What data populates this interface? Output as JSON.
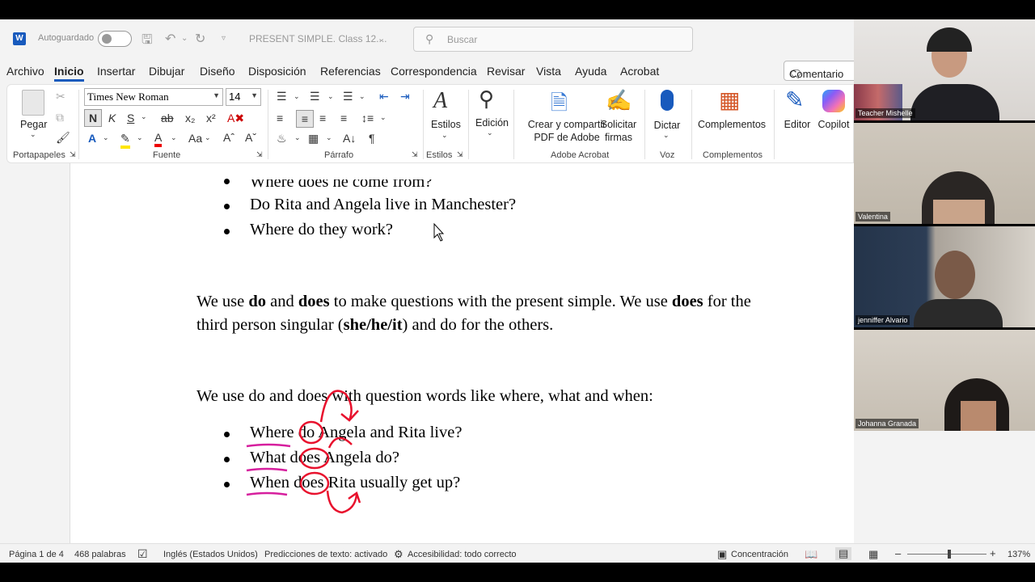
{
  "titlebar": {
    "autosave_label": "Autoguardado",
    "doc_title": "PRESENT SIMPLE. Class 12....",
    "search_placeholder": "Buscar"
  },
  "menu": {
    "items": [
      "Archivo",
      "Inicio",
      "Insertar",
      "Dibujar",
      "Diseño",
      "Disposición",
      "Referencias",
      "Correspondencia",
      "Revisar",
      "Vista",
      "Ayuda",
      "Acrobat"
    ],
    "comment_label": "Comentario"
  },
  "ribbon": {
    "paste_label": "Pegar",
    "font_name": "Times New Roman",
    "font_size": "14",
    "groups": {
      "clipboard": "Portapapeles",
      "font": "Fuente",
      "paragraph": "Párrafo",
      "styles": "Estilos",
      "acrobat": "Adobe Acrobat",
      "voice": "Voz",
      "addins": "Complementos"
    },
    "styles_label": "Estilos",
    "edit_label": "Edición",
    "create_pdf_label_1": "Crear y compartir",
    "create_pdf_label_2": "PDF de Adobe",
    "request_sign_label_1": "Solicitar",
    "request_sign_label_2": "firmas",
    "dictate_label": "Dictar",
    "addins_label": "Complementos",
    "editor_label": "Editor",
    "copilot_label": "Copilot",
    "bold_glyph": "N",
    "italic_glyph": "K",
    "underline_glyph": "S"
  },
  "document": {
    "top_bullets": [
      "Where does he come from?",
      "Do Rita and Angela live in Manchester?",
      "Where do they work?"
    ],
    "para1": {
      "pre": "We use ",
      "b1": "do",
      "mid1": " and ",
      "b2": "does",
      "mid2": " to make questions with the present simple. We use ",
      "b3": "does",
      "post": " for the",
      "line2_pre": "third person singular (",
      "line2_b": "she/he/it",
      "line2_post": ") and do for the others."
    },
    "para2": "We use do and does with question words like where, what and when:",
    "bottom_bullets": [
      "Where do Angela and Rita live?",
      "What does Angela do?",
      "When does Rita usually get up?"
    ]
  },
  "statusbar": {
    "page": "Página 1 de 4",
    "words": "468 palabras",
    "language": "Inglés (Estados Unidos)",
    "predictions": "Predicciones de texto: activado",
    "accessibility": "Accesibilidad: todo correcto",
    "focus": "Concentración",
    "zoom": "137%"
  },
  "participants": [
    {
      "name": "Teacher Mishelle"
    },
    {
      "name": "Valentina"
    },
    {
      "name": "jenniffer Alvario"
    },
    {
      "name": "Johanna Granada"
    }
  ],
  "colors": {
    "word_blue": "#185abd",
    "annotation_red": "#e8112d",
    "annotation_pink": "#d61f9e"
  }
}
